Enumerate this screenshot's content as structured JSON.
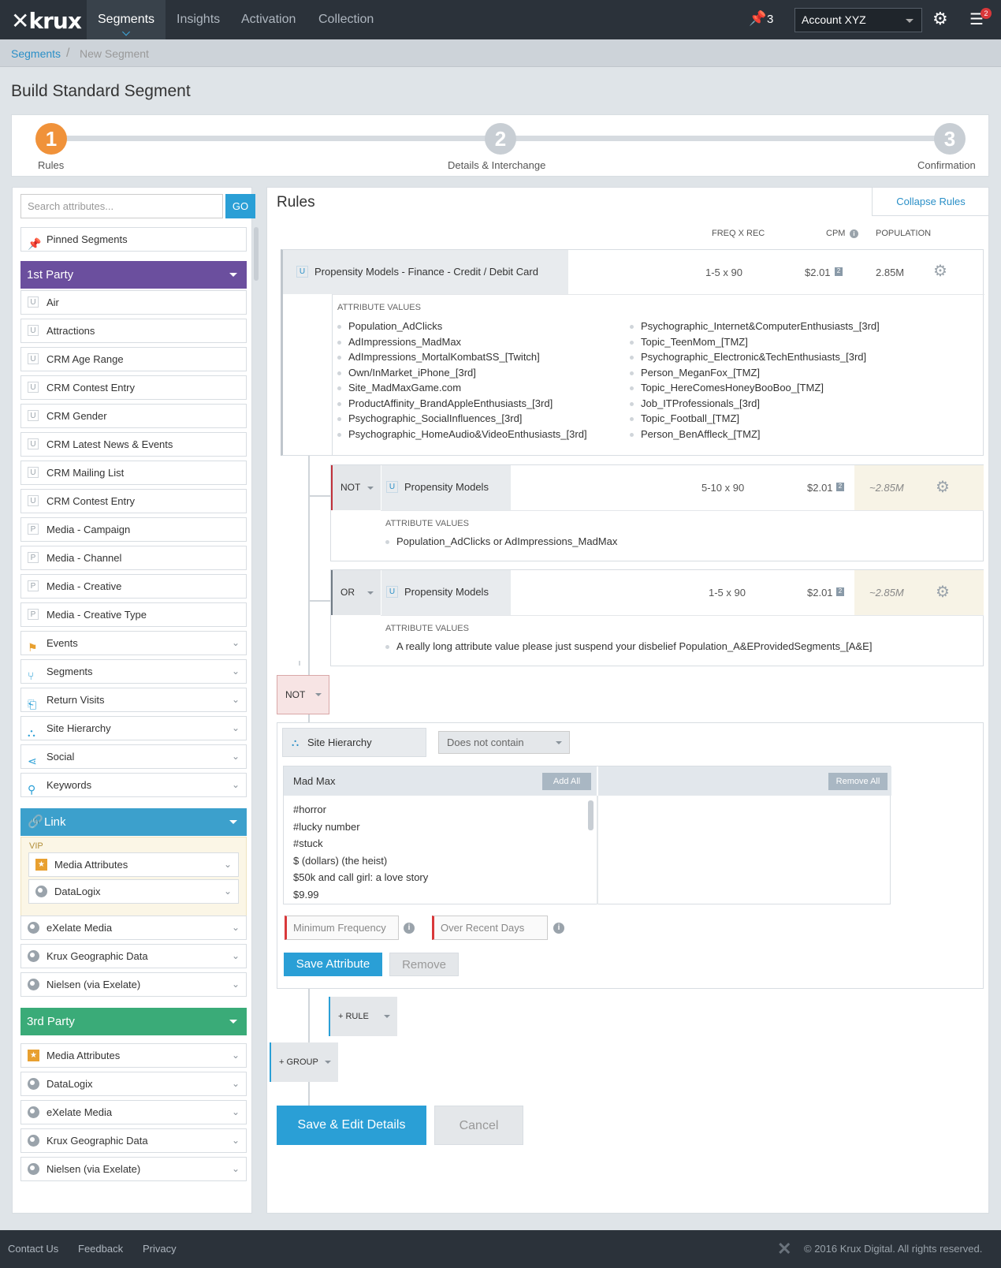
{
  "nav": {
    "logo": "krux",
    "tabs": [
      "Segments",
      "Insights",
      "Activation",
      "Collection"
    ],
    "pin_count": "3",
    "account": "Account XYZ",
    "notif_count": "2"
  },
  "breadcrumb": {
    "parent": "Segments",
    "sep": "/",
    "current": "New Segment"
  },
  "page_title": "Build Standard Segment",
  "steps": [
    {
      "num": "1",
      "label": "Rules"
    },
    {
      "num": "2",
      "label": "Details & Interchange"
    },
    {
      "num": "3",
      "label": "Confirmation"
    }
  ],
  "sidebar": {
    "search_placeholder": "Search attributes...",
    "go": "GO",
    "pinned": "Pinned Segments",
    "first_party": {
      "title": "1st Party",
      "color": "#6b4f9e",
      "items": [
        {
          "tag": "U",
          "label": "Air"
        },
        {
          "tag": "U",
          "label": "Attractions"
        },
        {
          "tag": "U",
          "label": "CRM Age Range"
        },
        {
          "tag": "U",
          "label": "CRM Contest Entry"
        },
        {
          "tag": "U",
          "label": "CRM Gender"
        },
        {
          "tag": "U",
          "label": "CRM Latest News & Events"
        },
        {
          "tag": "U",
          "label": "CRM Mailing List"
        },
        {
          "tag": "U",
          "label": "CRM Contest Entry"
        },
        {
          "tag": "P",
          "label": "Media - Campaign"
        },
        {
          "tag": "P",
          "label": "Media - Channel"
        },
        {
          "tag": "P",
          "label": "Media - Creative"
        },
        {
          "tag": "P",
          "label": "Media - Creative Type"
        }
      ],
      "groups": [
        "Events",
        "Segments",
        "Return Visits",
        "Site Hierarchy",
        "Social",
        "Keywords"
      ]
    },
    "link": {
      "title": "Link",
      "color": "#3ca0cc",
      "vip_label": "VIP",
      "vip_items": [
        "Media Attributes",
        "DataLogix"
      ],
      "items": [
        "eXelate Media",
        "Krux Geographic Data",
        "Nielsen (via Exelate)"
      ]
    },
    "third_party": {
      "title": "3rd Party",
      "color": "#3aab78",
      "items": [
        "Media Attributes",
        "DataLogix",
        "eXelate Media",
        "Krux Geographic Data",
        "Nielsen (via Exelate)"
      ]
    }
  },
  "rules": {
    "title": "Rules",
    "collapse": "Collapse Rules",
    "col_freq": "FREQ X REC",
    "col_cpm": "CPM",
    "col_pop": "POPULATION",
    "rule1": {
      "tag": "U",
      "name": "Propensity Models - Finance - Credit / Debit Card",
      "freq": "1-5 x 90",
      "cpm": "$2.01",
      "pop": "2.85M",
      "av_header": "ATTRIBUTE VALUES",
      "values_left": [
        "Population_AdClicks",
        "AdImpressions_MadMax",
        "AdImpressions_MortalKombatSS_[Twitch]",
        "Own/InMarket_iPhone_[3rd]",
        "Site_MadMaxGame.com",
        "ProductAffinity_BrandAppleEnthusiasts_[3rd]",
        "Psychographic_SocialInfluences_[3rd]",
        "Psychographic_HomeAudio&VideoEnthusiasts_[3rd]"
      ],
      "values_right": [
        "Psychographic_Internet&ComputerEnthusiasts_[3rd]",
        "Topic_TeenMom_[TMZ]",
        "Psychographic_Electronic&TechEnthusiasts_[3rd]",
        "Person_MeganFox_[TMZ]",
        "Topic_HereComesHoneyBooBoo_[TMZ]",
        "Job_ITProfessionals_[3rd]",
        "Topic_Football_[TMZ]",
        "Person_BenAffleck_[TMZ]"
      ]
    },
    "rule2": {
      "op": "NOT",
      "tag": "U",
      "name": "Propensity Models",
      "freq": "5-10 x 90",
      "cpm": "$2.01",
      "pop": "~2.85M",
      "av_header": "ATTRIBUTE VALUES",
      "value": "Population_AdClicks or AdImpressions_MadMax"
    },
    "rule3": {
      "op": "OR",
      "tag": "U",
      "name": "Propensity Models",
      "freq": "1-5 x 90",
      "cpm": "$2.01",
      "pop": "~2.85M",
      "av_header": "ATTRIBUTE VALUES",
      "value": "A really long attribute value please just suspend your disbelief Population_A&EProvidedSegments_[A&E]"
    },
    "editor": {
      "op": "NOT",
      "attribute": "Site Hierarchy",
      "condition": "Does not contain",
      "list_title": "Mad Max",
      "add_all": "Add All",
      "remove_all": "Remove All",
      "list": [
        "#horror",
        "#lucky number",
        "#stuck",
        "$ (dollars) (the heist)",
        "$50k and call girl: a love story",
        "$9.99"
      ],
      "min_freq": "Minimum Frequency",
      "over_days": "Over Recent Days",
      "save": "Save Attribute",
      "remove": "Remove"
    },
    "add_rule": "+ RULE",
    "add_group": "+ GROUP",
    "save_edit": "Save & Edit Details",
    "cancel": "Cancel"
  },
  "footer": {
    "links": [
      "Contact Us",
      "Feedback",
      "Privacy"
    ],
    "copyright": "© 2016 Krux Digital. All rights reserved."
  }
}
